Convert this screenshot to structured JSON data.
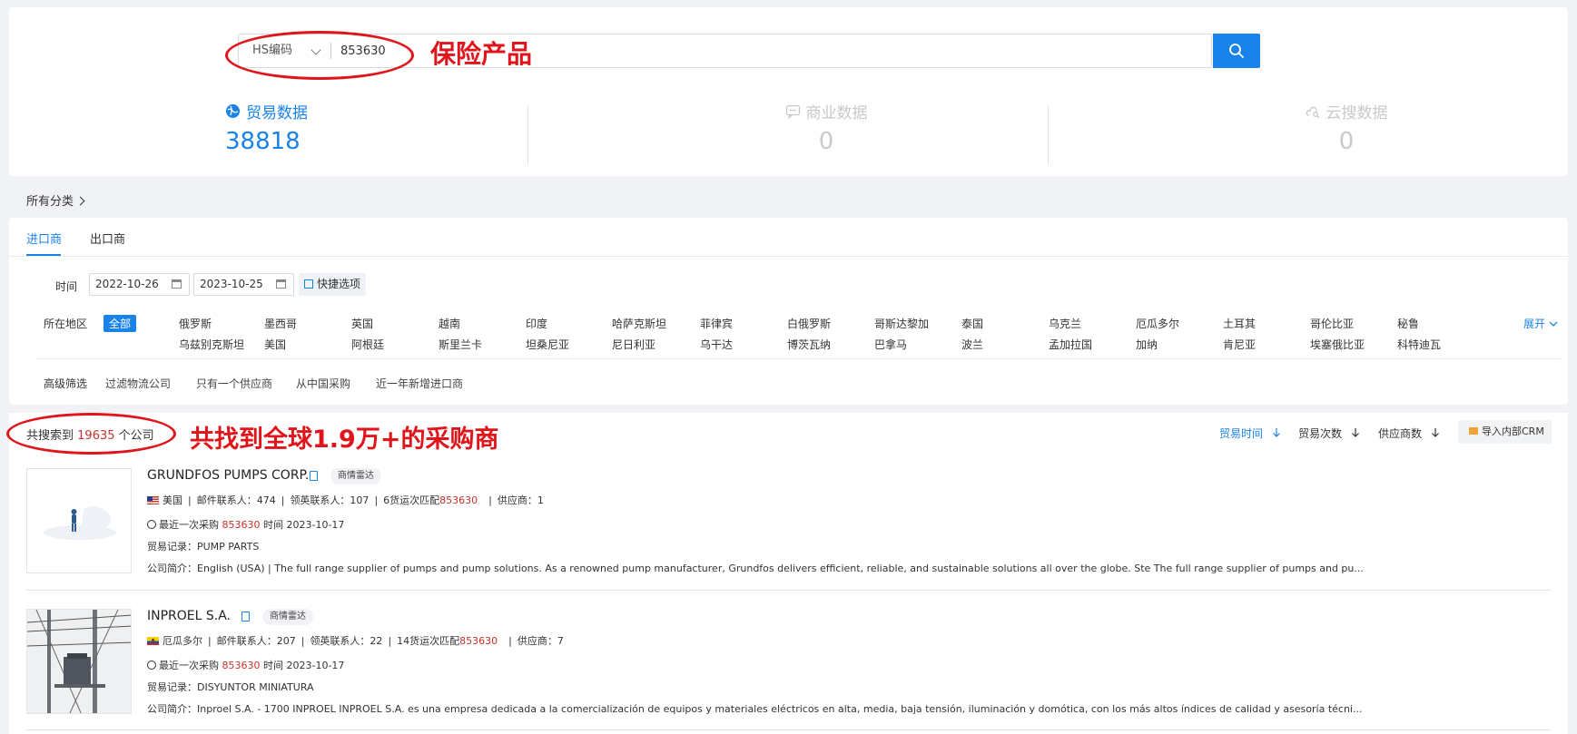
{
  "search": {
    "type_label": "HS编码",
    "value": "853630",
    "annotation": "保险产品"
  },
  "stats": [
    {
      "label": "贸易数据",
      "value": "38818",
      "icon": "globe-icon",
      "color": "#1a83ea"
    },
    {
      "label": "商业数据",
      "value": "0",
      "icon": "chat-icon",
      "color": "#cfcfcf"
    },
    {
      "label": "云搜数据",
      "value": "0",
      "icon": "cloud-search-icon",
      "color": "#cfcfcf"
    }
  ],
  "breadcrumb": "所有分类",
  "tabs": [
    "进口商",
    "出口商"
  ],
  "filters": {
    "time_label": "时间",
    "start_date": "2022-10-26",
    "end_date": "2023-10-25",
    "quick_label": "快捷选项",
    "region_label": "所在地区",
    "region_all": "全部",
    "regions_row1": [
      "俄罗斯",
      "墨西哥",
      "英国",
      "越南",
      "印度",
      "哈萨克斯坦",
      "菲律宾",
      "白俄罗斯",
      "哥斯达黎加",
      "泰国",
      "乌克兰",
      "厄瓜多尔",
      "土耳其",
      "哥伦比亚",
      "秘鲁"
    ],
    "regions_row2": [
      "乌兹别克斯坦",
      "美国",
      "阿根廷",
      "斯里兰卡",
      "坦桑尼亚",
      "尼日利亚",
      "乌干达",
      "博茨瓦纳",
      "巴拿马",
      "波兰",
      "孟加拉国",
      "加纳",
      "肯尼亚",
      "埃塞俄比亚",
      "科特迪瓦"
    ],
    "expand_label": "展开",
    "advanced_label": "高级筛选",
    "advanced_options": [
      "过滤物流公司",
      "只有一个供应商",
      "从中国采购",
      "近一年新增进口商"
    ]
  },
  "results": {
    "prefix": "共搜索到",
    "count": "19635",
    "suffix": "个公司",
    "annotation": "共找到全球1.9万+的采购商",
    "sorts": [
      "贸易时间",
      "贸易次数",
      "供应商数"
    ],
    "crm_label": "导入内部CRM"
  },
  "companies": [
    {
      "name": "GRUNDFOS PUMPS CORP.",
      "radar": "商情雷达",
      "country": "美国",
      "contacts": "邮件联系人：474",
      "linkedin": "领英联系人：107",
      "match_prefix": "6货运次匹配",
      "match_code": "853630",
      "suppliers": "供应商：1",
      "last_prefix": "最近一次采购",
      "last_code": "853630",
      "last_time": "时间 2023-10-17",
      "trade_record": "贸易记录：PUMP PARTS",
      "intro": "公司简介：English (USA) | The full range supplier of pumps and pump solutions. As a renowned pump manufacturer, Grundfos delivers efficient, reliable, and sustainable solutions all over the globe. Ste The full range supplier of pumps and pu..."
    },
    {
      "name": "INPROEL S.A.",
      "radar": "商情雷达",
      "country": "厄瓜多尔",
      "contacts": "邮件联系人：207",
      "linkedin": "领英联系人：22",
      "match_prefix": "14货运次匹配",
      "match_code": "853630",
      "suppliers": "供应商：7",
      "last_prefix": "最近一次采购",
      "last_code": "853630",
      "last_time": "时间 2023-10-17",
      "trade_record": "贸易记录：DISYUNTOR MINIATURA",
      "intro": "公司简介：Inproel S.A. - 1700 INPROEL INPROEL S.A. es una empresa dedicada a la comercialización de equipos y materiales eléctricos en alta, media, baja tensión, iluminación y domótica, con los más altos índices de calidad y asesoría técni..."
    }
  ],
  "colors": {
    "accent": "#1a83ea",
    "annotation": "#e0141b",
    "highlight": "#c8312b"
  }
}
